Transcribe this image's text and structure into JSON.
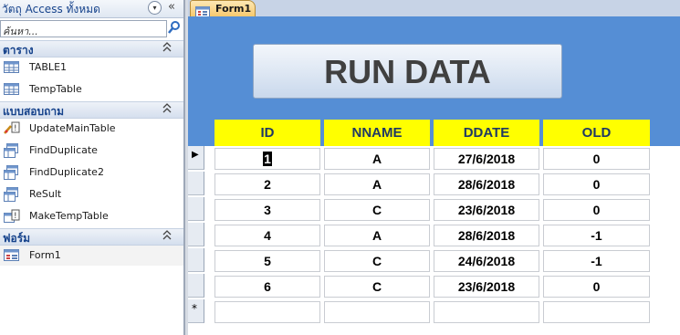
{
  "nav": {
    "title": "วัตถุ Access ทั้งหมด",
    "dropdown_glyph": "▾",
    "collapse_glyph": "«",
    "search": {
      "placeholder": "ค้นหา..."
    },
    "groups": [
      {
        "label": "ตาราง",
        "chevron": "⌃",
        "items": [
          {
            "label": "TABLE1",
            "icon": "table-icon"
          },
          {
            "label": "TempTable",
            "icon": "table-icon"
          }
        ]
      },
      {
        "label": "แบบสอบถาม",
        "chevron": "⌃",
        "items": [
          {
            "label": "UpdateMainTable",
            "icon": "update-query-icon"
          },
          {
            "label": "FindDuplicate",
            "icon": "select-query-icon"
          },
          {
            "label": "FindDuplicate2",
            "icon": "select-query-icon"
          },
          {
            "label": "ReSult",
            "icon": "select-query-icon"
          },
          {
            "label": "MakeTempTable",
            "icon": "make-table-query-icon"
          }
        ]
      },
      {
        "label": "ฟอร์ม",
        "chevron": "⌃",
        "items": [
          {
            "label": "Form1",
            "icon": "form-icon"
          }
        ]
      }
    ]
  },
  "document": {
    "tab_label": "Form1",
    "run_button_label": "RUN DATA",
    "columns": [
      "ID",
      "NNAME",
      "DDATE",
      "OLD"
    ],
    "rows": [
      [
        "1",
        "A",
        "27/6/2018",
        "0"
      ],
      [
        "2",
        "A",
        "28/6/2018",
        "0"
      ],
      [
        "3",
        "C",
        "23/6/2018",
        "0"
      ],
      [
        "4",
        "A",
        "28/6/2018",
        "-1"
      ],
      [
        "5",
        "C",
        "24/6/2018",
        "-1"
      ],
      [
        "6",
        "C",
        "23/6/2018",
        "0"
      ]
    ],
    "current_row_marker": "▶",
    "new_row_marker": "*"
  },
  "colors": {
    "header_background": "#558ed5",
    "column_header_fill": "#ffff00",
    "column_header_text": "#1f3864",
    "tab_fill": "#f7c76a"
  }
}
